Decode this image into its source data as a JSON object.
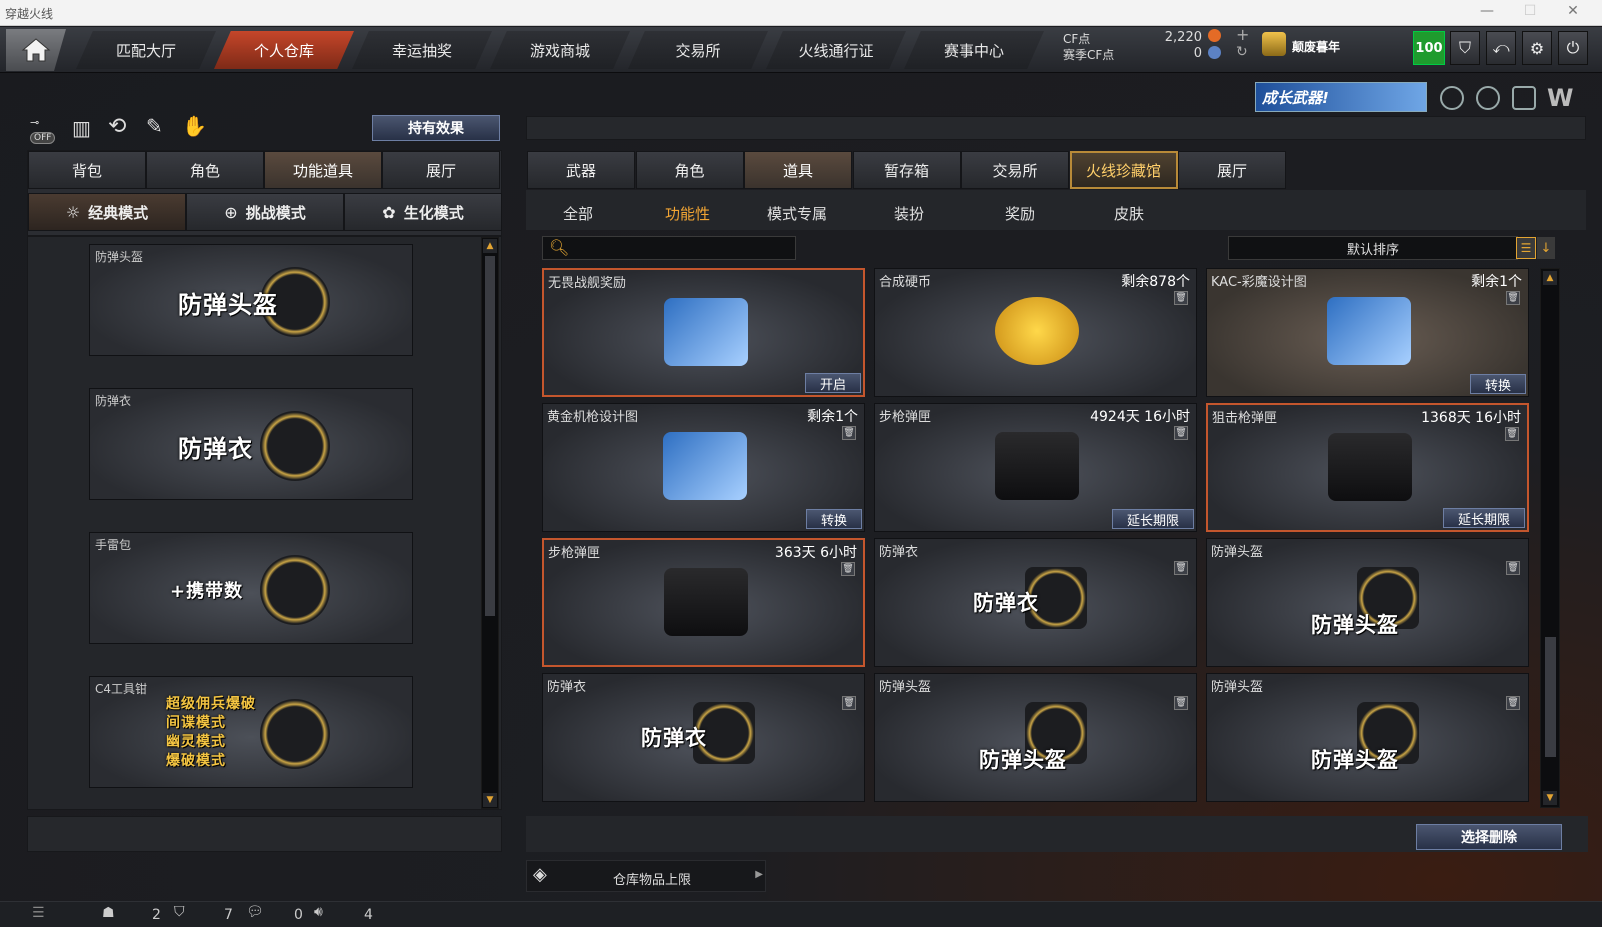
{
  "window": {
    "title": "穿越火线"
  },
  "nav": {
    "tabs": [
      "匹配大厅",
      "个人仓库",
      "幸运抽奖",
      "游戏商城",
      "交易所",
      "火线通行证",
      "赛事中心"
    ],
    "active": 1
  },
  "currency": {
    "cf_label": "CF点",
    "cf_value": "2,220",
    "season_label": "赛季CF点",
    "season_value": "0"
  },
  "user": {
    "name": "颠废暮年",
    "level": "100"
  },
  "banner": {
    "text": "成长武器!"
  },
  "left": {
    "effect_button": "持有效果",
    "off_label": "OFF",
    "tabs": [
      "背包",
      "角色",
      "功能道具",
      "展厅"
    ],
    "active_tab": 2,
    "modes": [
      "经典模式",
      "挑战模式",
      "生化模式"
    ],
    "cards": [
      {
        "name": "防弹头盔",
        "big": "防弹头盔",
        "icon": "helmet-icon"
      },
      {
        "name": "防弹衣",
        "big": "防弹衣",
        "icon": "vest-icon"
      },
      {
        "name": "手雷包",
        "big": "+携带数",
        "icon": "grenade-pack-icon"
      },
      {
        "name": "C4工具钳",
        "lines": [
          "超级佣兵爆破",
          "间谍模式",
          "幽灵模式",
          "爆破模式"
        ],
        "icon": "c4-tool-icon"
      }
    ]
  },
  "right": {
    "tabs": [
      "武器",
      "角色",
      "道具",
      "暂存箱",
      "交易所",
      "火线珍藏馆",
      "展厅"
    ],
    "active_tab": 2,
    "gold_tab": 5,
    "subtabs": [
      "全部",
      "功能性",
      "模式专属",
      "装扮",
      "奖励",
      "皮肤"
    ],
    "active_sub": 1,
    "search_placeholder": "",
    "sort_label": "默认排序",
    "items": [
      {
        "name": "无畏战舰奖励",
        "right": "",
        "action": "开启",
        "trash": false,
        "hl": true,
        "big": "",
        "icon": "blueprint-book-icon"
      },
      {
        "name": "合成硬币",
        "right": "剩余878个",
        "action": "",
        "trash": true,
        "hl": false,
        "big": "",
        "icon": "coin-icon"
      },
      {
        "name": "KAC-彩魔设计图",
        "right": "剩余1个",
        "action": "转换",
        "trash": true,
        "hl": false,
        "warm": true,
        "big": "",
        "icon": "rifle-blueprint-icon"
      },
      {
        "name": "黄金机枪设计图",
        "right": "剩余1个",
        "action": "转换",
        "trash": true,
        "hl": false,
        "big": "",
        "icon": "mech-blueprint-icon"
      },
      {
        "name": "步枪弹匣",
        "right": "4924天 16小时",
        "action": "延长期限",
        "trash": true,
        "hl": false,
        "big": "",
        "icon": "rifle-magazine-icon"
      },
      {
        "name": "狙击枪弹匣",
        "right": "1368天 16小时",
        "action": "延长期限",
        "trash": true,
        "hl": true,
        "big": "",
        "icon": "sniper-magazine-icon"
      },
      {
        "name": "步枪弹匣",
        "right": "363天 6小时",
        "action": "",
        "trash": true,
        "hl": true,
        "big": "",
        "icon": "rifle-magazine-icon"
      },
      {
        "name": "防弹衣",
        "right": "",
        "action": "",
        "trash": true,
        "hl": false,
        "big": "防弹衣",
        "icon": "vest-icon"
      },
      {
        "name": "防弹头盔",
        "right": "",
        "action": "",
        "trash": true,
        "hl": false,
        "big": "防弹头盔",
        "icon": "helmet-icon"
      },
      {
        "name": "防弹衣",
        "right": "",
        "action": "",
        "trash": true,
        "hl": false,
        "big": "防弹衣",
        "icon": "vest-icon"
      },
      {
        "name": "防弹头盔",
        "right": "",
        "action": "",
        "trash": true,
        "hl": false,
        "big": "防弹头盔",
        "icon": "helmet-icon"
      },
      {
        "name": "防弹头盔",
        "right": "",
        "action": "",
        "trash": true,
        "hl": false,
        "big": "防弹头盔",
        "icon": "helmet-icon"
      }
    ],
    "delete_button": "选择删除",
    "capacity_label": "仓库物品上限"
  },
  "status": {
    "c1": "2",
    "c2": "7",
    "c3": "0",
    "c4": "4"
  },
  "colors": {
    "accent": "#c4562d",
    "gold": "#f2a534",
    "level": "#1f9b2e"
  }
}
